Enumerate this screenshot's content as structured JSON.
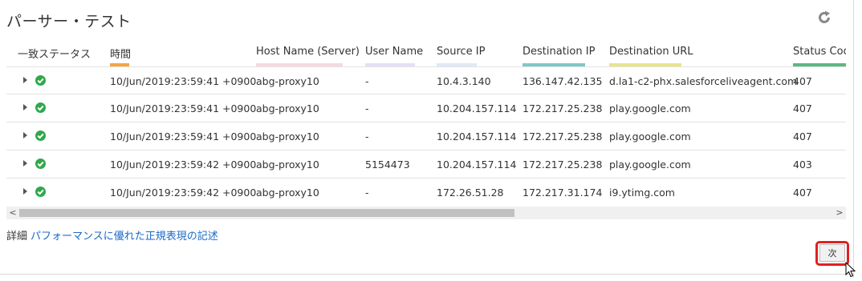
{
  "page": {
    "title": "パーサー・テスト"
  },
  "table": {
    "columns": [
      {
        "label": "一致ステータス",
        "color": ""
      },
      {
        "label": "時間",
        "color": "#f5a442"
      },
      {
        "label": "Host Name (Server)",
        "color": "#f6d9e0"
      },
      {
        "label": "User Name",
        "color": "#e6dff5"
      },
      {
        "label": "Source IP",
        "color": "#e1e8f5"
      },
      {
        "label": "Destination IP",
        "color": "#7fc9c9"
      },
      {
        "label": "Destination URL",
        "color": "#e7e58a"
      },
      {
        "label": "Status Code",
        "color": "#5cb884"
      }
    ],
    "rows": [
      {
        "time": "10/Jun/2019:23:59:41 +0900",
        "host": "abg-proxy10",
        "user": "-",
        "src": "10.4.3.140",
        "dst": "136.147.42.135",
        "url": "d.la1-c2-phx.salesforceliveagent.com",
        "status": "407"
      },
      {
        "time": "10/Jun/2019:23:59:41 +0900",
        "host": "abg-proxy10",
        "user": "-",
        "src": "10.204.157.114",
        "dst": "172.217.25.238",
        "url": "play.google.com",
        "status": "407"
      },
      {
        "time": "10/Jun/2019:23:59:41 +0900",
        "host": "abg-proxy10",
        "user": "-",
        "src": "10.204.157.114",
        "dst": "172.217.25.238",
        "url": "play.google.com",
        "status": "407"
      },
      {
        "time": "10/Jun/2019:23:59:42 +0900",
        "host": "abg-proxy10",
        "user": "5154473",
        "src": "10.204.157.114",
        "dst": "172.217.25.238",
        "url": "play.google.com",
        "status": "403"
      },
      {
        "time": "10/Jun/2019:23:59:42 +0900",
        "host": "abg-proxy10",
        "user": "-",
        "src": "172.26.51.28",
        "dst": "172.217.31.174",
        "url": "i9.ytimg.com",
        "status": "407"
      }
    ]
  },
  "scroll": {
    "left_arrow": "<",
    "right_arrow": ">"
  },
  "footer": {
    "detail_label": "詳細",
    "detail_link": "パフォーマンスに優れた正規表現の記述"
  },
  "actions": {
    "next_label": "次"
  }
}
